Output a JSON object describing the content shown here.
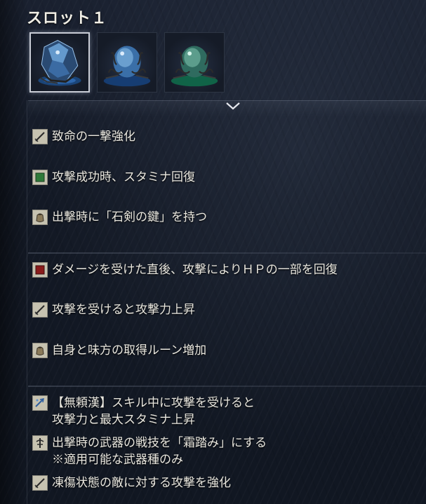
{
  "title": "スロット１",
  "relics": [
    {
      "name": "crystal-relic",
      "color": "#7fb6e8",
      "selected": true
    },
    {
      "name": "blue-orb-relic",
      "color": "#4f8fc8",
      "selected": false
    },
    {
      "name": "green-orb-relic",
      "color": "#3fae7a",
      "selected": false
    }
  ],
  "effects": [
    {
      "icon": "sword-icon",
      "lines": [
        "致命の一撃強化"
      ]
    },
    {
      "icon": "green-square-icon",
      "lines": [
        "攻撃成功時、スタミナ回復"
      ]
    },
    {
      "icon": "pouch-icon",
      "lines": [
        "出撃時に「石剣の鍵」を持つ"
      ]
    },
    {
      "icon": "red-square-icon",
      "lines": [
        "ダメージを受けた直後、攻撃によりＨＰの一部を回復"
      ]
    },
    {
      "icon": "sword-icon",
      "lines": [
        "攻撃を受けると攻撃力上昇"
      ]
    },
    {
      "icon": "pouch-icon",
      "lines": [
        "自身と味方の取得ルーン増加"
      ]
    },
    {
      "icon": "skill-icon",
      "lines": [
        "【無頼漢】スキル中に攻撃を受けると",
        "攻撃力と最大スタミナ上昇"
      ]
    },
    {
      "icon": "art-icon",
      "lines": [
        "出撃時の武器の戦技を「霜踏み」にする",
        "※適用可能な武器種のみ"
      ]
    },
    {
      "icon": "sword-icon",
      "lines": [
        "凍傷状態の敵に対する攻撃を強化"
      ]
    }
  ],
  "colors": {
    "accent_green": "#2f7a3a",
    "accent_red": "#8a1c1c",
    "icon_bg": "#c6c2b0",
    "text": "#e9e7df"
  }
}
